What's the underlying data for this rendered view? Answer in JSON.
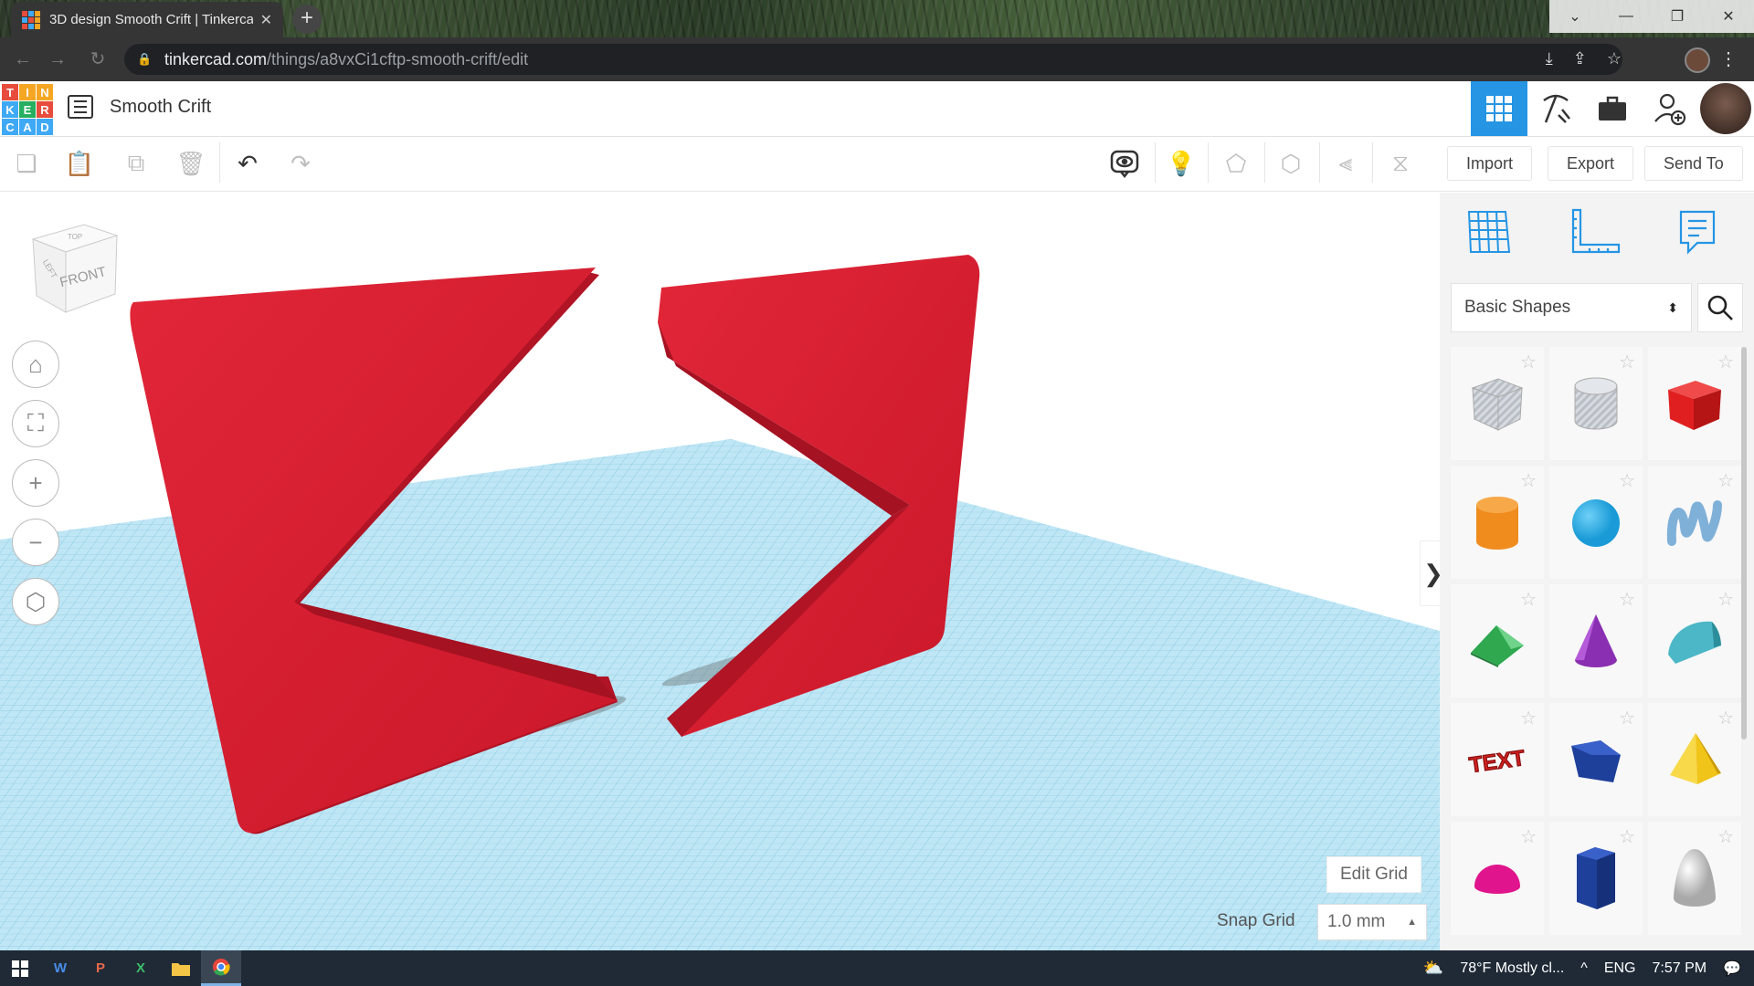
{
  "browser": {
    "tab_title": "3D design Smooth Crift | Tinkercad",
    "url_host": "tinkercad.com",
    "url_path": "/things/a8vxCi1cftp-smooth-crift/edit",
    "new_tab_symbol": "+",
    "close_symbol": "✕"
  },
  "logo": {
    "letters": [
      "T",
      "I",
      "N",
      "K",
      "E",
      "R",
      "C",
      "A",
      "D"
    ],
    "colors": [
      "#e74c3c",
      "#f5a623",
      "#f5a623",
      "#3fa9f5",
      "#27ae60",
      "#e74c3c",
      "#3fa9f5",
      "#3fa9f5",
      "#3fa9f5"
    ]
  },
  "header": {
    "design_title": "Smooth Crift"
  },
  "toolbar": {
    "import_label": "Import",
    "export_label": "Export",
    "send_to_label": "Send To"
  },
  "viewcube": {
    "front_label": "FRONT",
    "left_label": "LEFT",
    "top_label": "TOP"
  },
  "canvas": {
    "edit_grid_label": "Edit Grid",
    "snap_grid_label": "Snap Grid",
    "snap_grid_value": "1.0 mm",
    "collapse_symbol": "❯"
  },
  "panel": {
    "category": "Basic Shapes",
    "shapes": [
      {
        "name": "box-hole",
        "color": "#c4c9d0"
      },
      {
        "name": "cylinder-hole",
        "color": "#c4c9d0"
      },
      {
        "name": "box",
        "color": "#e02020"
      },
      {
        "name": "cylinder",
        "color": "#f08c1e"
      },
      {
        "name": "sphere",
        "color": "#1a9bd7"
      },
      {
        "name": "scribble",
        "color": "#7fb0d8"
      },
      {
        "name": "roof",
        "color": "#2fa84f"
      },
      {
        "name": "cone",
        "color": "#8a2fb2"
      },
      {
        "name": "round-roof",
        "color": "#4cb7c6"
      },
      {
        "name": "text",
        "color": "#d02020",
        "label": "TEXT"
      },
      {
        "name": "polygon",
        "color": "#1e3f9a"
      },
      {
        "name": "pyramid",
        "color": "#f0c419"
      },
      {
        "name": "half-sphere",
        "color": "#e0148c"
      },
      {
        "name": "hexagonal-prism",
        "color": "#1e3f9a"
      },
      {
        "name": "paraboloid",
        "color": "#d8d8d8"
      }
    ]
  },
  "taskbar": {
    "weather": "78°F  Mostly cl...",
    "language": "ENG",
    "time": "7:57 PM",
    "apps": [
      "W",
      "P",
      "X"
    ]
  }
}
